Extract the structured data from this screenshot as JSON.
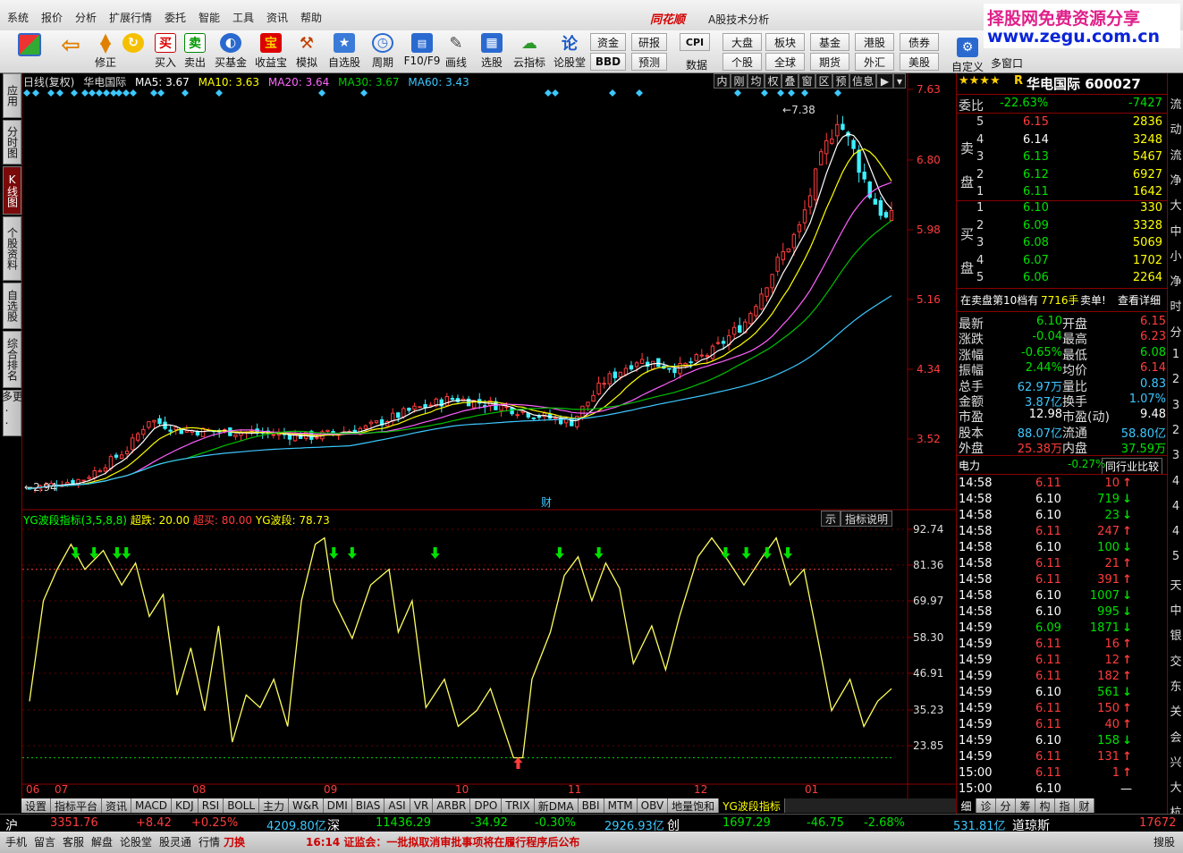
{
  "menu": [
    "系统",
    "报价",
    "分析",
    "扩展行情",
    "委托",
    "智能",
    "工具",
    "资讯",
    "帮助"
  ],
  "app_title": "同花顺",
  "app_subtitle": "A股技术分析",
  "watermark": {
    "line1": "择股网免费资源分享",
    "line2": "www.zegu.com.cn"
  },
  "toolbar": {
    "buttons": [
      {
        "label": "",
        "icon": "grid-icon"
      },
      {
        "label": "",
        "icon": "back-arrow-icon"
      },
      {
        "label": "修正",
        "icon": "updown-arrow-icon"
      },
      {
        "label": "",
        "icon": "refresh-icon"
      },
      {
        "label": "买入",
        "icon": "buy-icon",
        "glyph": "买"
      },
      {
        "label": "卖出",
        "icon": "sell-icon",
        "glyph": "卖"
      },
      {
        "label": "买基金",
        "icon": "fund-icon"
      },
      {
        "label": "收益宝",
        "icon": "treasure-icon",
        "glyph": "宝"
      },
      {
        "label": "模拟",
        "icon": "hammer-icon"
      },
      {
        "label": "自选股",
        "icon": "star-icon"
      },
      {
        "label": "周期",
        "icon": "clock-icon"
      },
      {
        "label": "F10/F9",
        "icon": "f10-icon"
      },
      {
        "label": "画线",
        "icon": "pen-icon"
      },
      {
        "label": "选股",
        "icon": "select-icon"
      },
      {
        "label": "云指标",
        "icon": "cloud-icon"
      },
      {
        "label": "论股堂",
        "icon": "forum-icon",
        "glyph": "论"
      }
    ],
    "small_buttons": [
      "资金",
      "BBD",
      "研报",
      "预测",
      "CPI",
      "数据",
      "大盘",
      "个股",
      "板块",
      "全球",
      "基金",
      "期货",
      "港股",
      "外汇",
      "债券",
      "美股",
      "自定义",
      "多窗口"
    ]
  },
  "left_tabs": [
    "应用",
    "分时图",
    "K线图",
    "个股资料",
    "自选股",
    "综合排名",
    "更多.."
  ],
  "price_header": {
    "period": "日线(复权)",
    "name": "华电国际",
    "ma5": "MA5: 3.67",
    "ma10": "MA10: 3.63",
    "ma20": "MA20: 3.64",
    "ma30": "MA30: 3.67",
    "ma60": "MA60: 3.43"
  },
  "price_tabs": [
    "内",
    "刚",
    "均",
    "权",
    "叠",
    "窗",
    "区",
    "预",
    "信息"
  ],
  "price_axis": [
    "7.63",
    "6.80",
    "5.98",
    "5.16",
    "4.34",
    "3.52"
  ],
  "price_labels": {
    "high": "7.38",
    "low": "2.94",
    "cai": "财"
  },
  "indicator_header": {
    "name": "YG波段指标(3,5,8,8)",
    "oversell": "超跌: 20.00",
    "overbuy": "超买: 80.00",
    "value": "YG波段: 78.73"
  },
  "indicator_buttons": [
    "示",
    "指标说明"
  ],
  "indicator_axis": [
    "92.74",
    "81.36",
    "69.97",
    "58.30",
    "46.91",
    "35.23",
    "23.85"
  ],
  "x_labels": [
    "06",
    "07",
    "08",
    "09",
    "10",
    "11",
    "12",
    "01"
  ],
  "bottom_tabs": [
    "设置",
    "指标平台",
    "资讯",
    "MACD",
    "KDJ",
    "RSI",
    "BOLL",
    "主力",
    "W&R",
    "DMI",
    "BIAS",
    "ASI",
    "VR",
    "ARBR",
    "DPO",
    "TRIX",
    "新DMA",
    "BBI",
    "MTM",
    "OBV",
    "地量饱和",
    "YG波段指标"
  ],
  "quote": {
    "stars": "★★★★",
    "r": "R",
    "title": "华电国际 600027",
    "weibi_label": "委比",
    "weibi": "-22.63%",
    "weicha": "-7427",
    "sell_label": "卖盘",
    "buy_label": "买盘",
    "sell": [
      {
        "lvl": "5",
        "p": "6.15",
        "v": "2836"
      },
      {
        "lvl": "4",
        "p": "6.14",
        "v": "3248"
      },
      {
        "lvl": "3",
        "p": "6.13",
        "v": "5467"
      },
      {
        "lvl": "2",
        "p": "6.12",
        "v": "6927"
      },
      {
        "lvl": "1",
        "p": "6.11",
        "v": "1642"
      }
    ],
    "buy": [
      {
        "lvl": "1",
        "p": "6.10",
        "v": "330"
      },
      {
        "lvl": "2",
        "p": "6.09",
        "v": "3328"
      },
      {
        "lvl": "3",
        "p": "6.08",
        "v": "5069"
      },
      {
        "lvl": "4",
        "p": "6.07",
        "v": "1702"
      },
      {
        "lvl": "5",
        "p": "6.06",
        "v": "2264"
      }
    ],
    "notice": "在卖盘第10档有",
    "notice_qty": "7716手",
    "notice_sell": "卖单!",
    "notice_detail": "查看详细",
    "stats": [
      {
        "l1": "最新",
        "v1": "6.10",
        "l2": "开盘",
        "v2": "6.15"
      },
      {
        "l1": "涨跌",
        "v1": "-0.04",
        "l2": "最高",
        "v2": "6.23"
      },
      {
        "l1": "涨幅",
        "v1": "-0.65%",
        "l2": "最低",
        "v2": "6.08"
      },
      {
        "l1": "振幅",
        "v1": "2.44%",
        "l2": "均价",
        "v2": "6.14"
      },
      {
        "l1": "总手",
        "v1": "62.97万",
        "l2": "量比",
        "v2": "0.83"
      },
      {
        "l1": "金额",
        "v1": "3.87亿",
        "l2": "换手",
        "v2": "1.07%"
      },
      {
        "l1": "市盈",
        "v1": "12.98",
        "l2": "市盈(动)",
        "v2": "9.48"
      },
      {
        "l1": "股本",
        "v1": "88.07亿",
        "l2": "流通",
        "v2": "58.80亿"
      },
      {
        "l1": "外盘",
        "v1": "25.38万",
        "l2": "内盘",
        "v2": "37.59万"
      }
    ],
    "industry": "电力",
    "industry_chg": "-0.27%",
    "industry_btn": "同行业比较",
    "ticks": [
      {
        "t": "14:58",
        "p": "6.11",
        "v": "10",
        "d": "up"
      },
      {
        "t": "14:58",
        "p": "6.10",
        "v": "719",
        "d": "down"
      },
      {
        "t": "14:58",
        "p": "6.10",
        "v": "23",
        "d": "down"
      },
      {
        "t": "14:58",
        "p": "6.11",
        "v": "247",
        "d": "up"
      },
      {
        "t": "14:58",
        "p": "6.10",
        "v": "100",
        "d": "down"
      },
      {
        "t": "14:58",
        "p": "6.11",
        "v": "21",
        "d": "up"
      },
      {
        "t": "14:58",
        "p": "6.11",
        "v": "391",
        "d": "up"
      },
      {
        "t": "14:58",
        "p": "6.10",
        "v": "1007",
        "d": "down"
      },
      {
        "t": "14:58",
        "p": "6.10",
        "v": "995",
        "d": "down"
      },
      {
        "t": "14:59",
        "p": "6.09",
        "v": "1871",
        "d": "down"
      },
      {
        "t": "14:59",
        "p": "6.11",
        "v": "16",
        "d": "up"
      },
      {
        "t": "14:59",
        "p": "6.11",
        "v": "12",
        "d": "up"
      },
      {
        "t": "14:59",
        "p": "6.11",
        "v": "182",
        "d": "up"
      },
      {
        "t": "14:59",
        "p": "6.10",
        "v": "561",
        "d": "down"
      },
      {
        "t": "14:59",
        "p": "6.11",
        "v": "150",
        "d": "up"
      },
      {
        "t": "14:59",
        "p": "6.11",
        "v": "40",
        "d": "up"
      },
      {
        "t": "14:59",
        "p": "6.10",
        "v": "158",
        "d": "down"
      },
      {
        "t": "14:59",
        "p": "6.11",
        "v": "131",
        "d": "up"
      },
      {
        "t": "15:00",
        "p": "6.11",
        "v": "1",
        "d": "up"
      },
      {
        "t": "15:00",
        "p": "6.10",
        "v": "",
        "d": "none"
      }
    ],
    "right_tabs": [
      "细",
      "诊",
      "分",
      "筹",
      "构",
      "指",
      "财"
    ],
    "dash": "—"
  },
  "right_strip": [
    "流",
    "动",
    "流",
    "净",
    "大",
    "中",
    "小",
    "净",
    "时",
    "分",
    "1",
    "2",
    "3",
    "2",
    "3",
    "4",
    "4",
    "4",
    "5",
    "天",
    "中",
    "银",
    "交",
    "东",
    "关",
    "会",
    "兴",
    "大",
    "杭"
  ],
  "status": {
    "sh_label": "沪",
    "sh_idx": "3351.76",
    "sh_chg": "+8.42",
    "sh_pct": "+0.25%",
    "sh_amt": "4209.80亿",
    "sz_label": "深",
    "sz_idx": "11436.29",
    "sz_chg": "-34.92",
    "sz_pct": "-0.30%",
    "sz_amt": "2926.93亿",
    "cy_label": "创",
    "cy_idx": "1697.29",
    "cy_chg": "-46.75",
    "cy_pct": "-2.68%",
    "cy_amt": "531.81亿",
    "dj_label": "道琼斯",
    "dj_idx": "17672"
  },
  "status2": {
    "items": [
      "手机",
      "留言",
      "客服",
      "解盘",
      "论股堂",
      "股灵通",
      "行情",
      "刀换"
    ],
    "news": "16:14 证监会：一批拟取消审批事项将在履行程序后公布",
    "right": "搜股"
  },
  "colors": {
    "up": "#ff3c3c",
    "down": "#00e000",
    "ma5": "#ffffff",
    "ma10": "#ffff00",
    "ma20": "#ff60ff",
    "ma30": "#00c000",
    "ma60": "#3cc8ff",
    "indicator": "#ffff60"
  }
}
